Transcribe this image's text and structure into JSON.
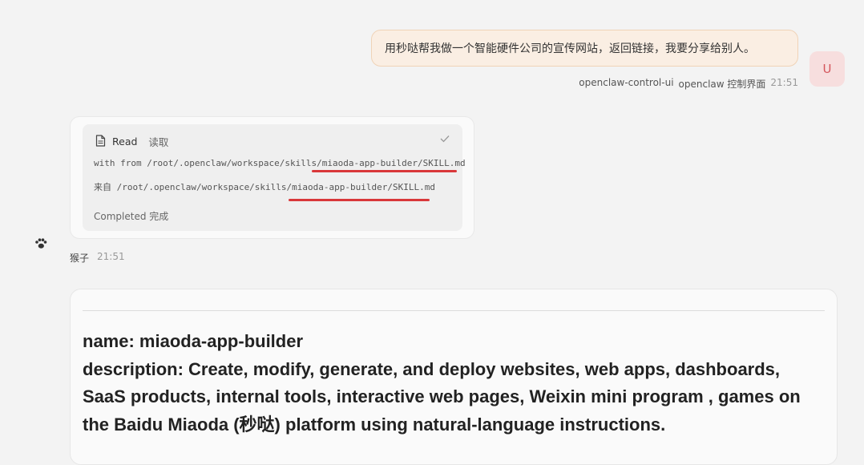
{
  "user_message": {
    "text": "用秒哒帮我做一个智能硬件公司的宣传网站，返回链接，我要分享给别人。",
    "avatar_letter": "U",
    "sender": "openclaw-control-ui",
    "channel": "openclaw 控制界面",
    "time": "21:51"
  },
  "tool_call": {
    "name": "Read",
    "name_zh": "读取",
    "line_en": "with from /root/.openclaw/workspace/skills/miaoda-app-builder/SKILL.md",
    "line_zh": "来自 /root/.openclaw/workspace/skills/miaoda-app-builder/SKILL.md",
    "status": "Completed 完成",
    "icons": {
      "file": "file-icon",
      "check": "check-icon",
      "avatar": "paw-icon"
    }
  },
  "bot": {
    "name": "猴子",
    "time": "21:51"
  },
  "skill_doc": {
    "lines": [
      "name: miaoda-app-builder",
      "description: Create, modify, generate, and deploy websites, web apps, dashboards,",
      "SaaS products, internal tools, interactive web pages, Weixin mini program , games on",
      "the Baidu Miaoda (秒哒) platform using natural-language instructions."
    ]
  },
  "colors": {
    "user_bubble_bg": "#faeee3",
    "user_bubble_border": "#f0d3b7",
    "avatar_bg": "#f7dede",
    "avatar_text": "#d4555b",
    "highlight_red": "#d9383a",
    "page_bg": "#f3f3f3"
  }
}
